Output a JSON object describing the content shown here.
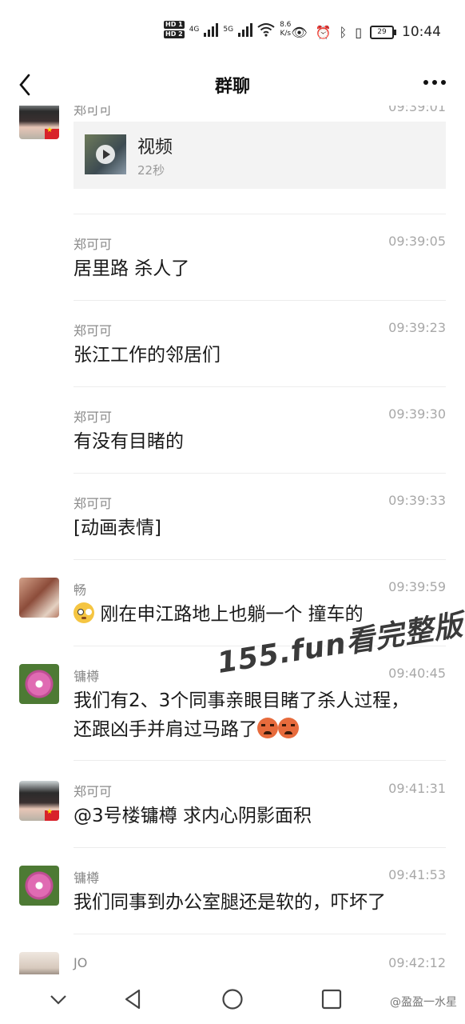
{
  "status_bar": {
    "network_speed": "8.6",
    "network_unit": "K/s",
    "battery": "29",
    "time": "10:44",
    "sim1": "HD 1",
    "sim2": "HD 2",
    "net1": "4G",
    "net2": "5G"
  },
  "header": {
    "title": "群聊"
  },
  "messages": [
    {
      "sender": "郑可可",
      "time": "09:39:01",
      "type": "video",
      "video_title": "视频",
      "video_duration": "22秒",
      "avatar": "girl-avatar"
    },
    {
      "sender": "郑可可",
      "time": "09:39:05",
      "text": "居里路 杀人了"
    },
    {
      "sender": "郑可可",
      "time": "09:39:23",
      "text": "张江工作的邻居们"
    },
    {
      "sender": "郑可可",
      "time": "09:39:30",
      "text": "有没有目睹的"
    },
    {
      "sender": "郑可可",
      "time": "09:39:33",
      "text": "[动画表情]"
    },
    {
      "sender": "畅",
      "time": "09:39:59",
      "text": "刚在申江路地上也躺一个 撞车的",
      "emoji": "flushed-face-icon",
      "avatar": "chang-avatar"
    },
    {
      "sender": "镛樽",
      "time": "09:40:45",
      "text_line1": "我们有2、3个同事亲眼目睹了杀人过程，",
      "text_line2": "还跟凶手并肩过马路了",
      "emoji": "angry-face-icon",
      "avatar": "flower-avatar"
    },
    {
      "sender": "郑可可",
      "time": "09:41:31",
      "text": "@3号楼镛樽 求内心阴影面积",
      "avatar": "girl-avatar"
    },
    {
      "sender": "镛樽",
      "time": "09:41:53",
      "text": "我们同事到办公室腿还是软的，吓坏了",
      "avatar": "flower-avatar"
    },
    {
      "sender": "JO",
      "time": "09:42:12",
      "avatar": "jo-avatar"
    }
  ],
  "watermark": "155.fun看完整版",
  "weibo_tag": "@盈盈一水星",
  "colors": {
    "background": "#ffffff",
    "divider": "#ececec",
    "meta_text": "#a8a8a8"
  }
}
